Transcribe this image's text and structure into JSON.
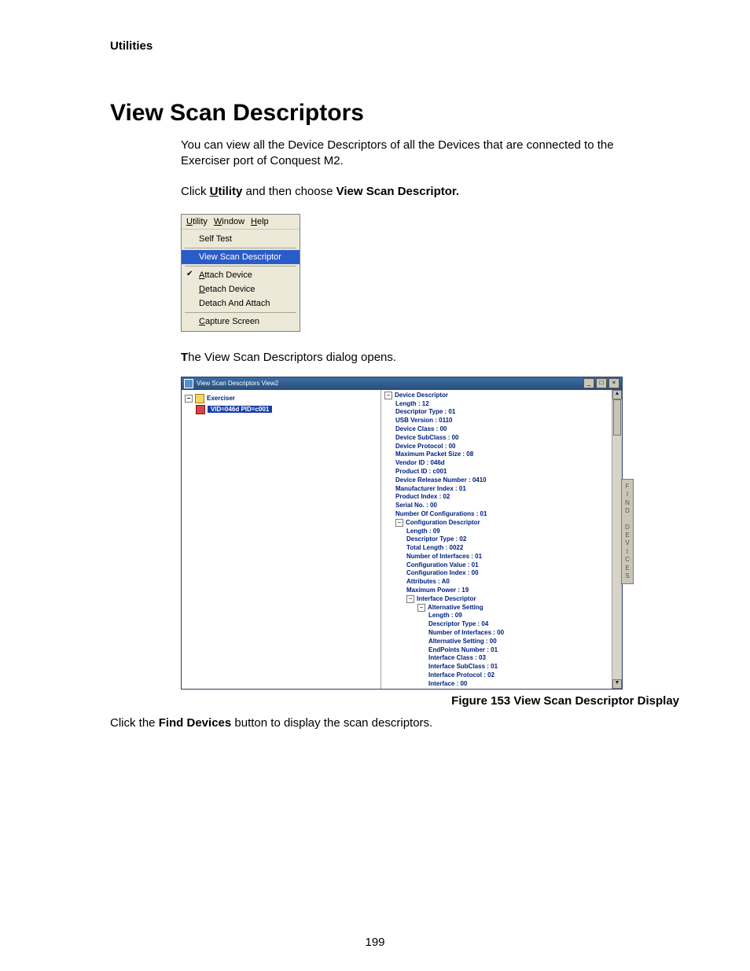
{
  "running_header": "Utilities",
  "h1": "View Scan Descriptors",
  "para1": "You can view all the Device Descriptors of all the Devices that are connected to the Exerciser port of Conquest M2.",
  "para2_prefix": "Click ",
  "para2_utility_u": "U",
  "para2_utility_rest": "tility",
  "para2_mid": " and then choose ",
  "para2_cmd": "View Scan Descriptor.",
  "menu": {
    "bar": {
      "utility_u": "U",
      "utility_rest": "tility",
      "window_u": "W",
      "window_rest": "indow",
      "help_u": "H",
      "help_rest": "elp"
    },
    "items": {
      "self_test": "Self Test",
      "view_scan": "View Scan Descriptor",
      "attach_u": "A",
      "attach_rest": "ttach Device",
      "detach_u": "D",
      "detach_rest": "etach Device",
      "detach_attach": "Detach And Attach",
      "capture_u": "C",
      "capture_rest": "apture Screen"
    }
  },
  "caption2_t": "T",
  "caption2_rest": "he View Scan Descriptors dialog opens.",
  "vsd": {
    "title": "View Scan Descriptors View2",
    "btn_min": "_",
    "btn_max": "□",
    "btn_close": "×",
    "tree": {
      "root": "Exerciser",
      "child": "VID=046d  PID=c001"
    },
    "side_tab": "FIND DEVICES",
    "details": [
      "Device Descriptor",
      "Length : 12",
      "Descriptor Type : 01",
      "USB Version : 0110",
      "Device Class : 00",
      "Device SubClass : 00",
      "Device Protocol : 00",
      "Maximum Packet Size : 08",
      "Vendor ID : 046d",
      "Product ID : c001",
      "Device Release Number : 0410",
      "Manufacturer Index : 01",
      "Product Index : 02",
      "Serial No. : 00",
      "Number Of Configurations : 01",
      "Configuration Descriptor",
      "Length : 09",
      "Descriptor Type : 02",
      "Total Length : 0022",
      "Number of Interfaces : 01",
      "Configuration Value : 01",
      "Configuration Index : 00",
      "Attributes : A0",
      "Maximum Power : 19",
      "Interface Descriptor",
      "Alternative Setting",
      "Length : 09",
      "Descriptor Type : 04",
      "Number of Interfaces : 00",
      "Alternative Setting : 00",
      "EndPoints Number : 01",
      "Interface Class : 03",
      "Interface SubClass : 01",
      "Interface Protocol : 02",
      "Interface : 00"
    ]
  },
  "fig_caption": "Figure  153  View Scan Descriptor Display",
  "para3_a": "Click the ",
  "para3_b": "Find Devices",
  "para3_c": " button to display the scan descriptors.",
  "page_num": "199"
}
